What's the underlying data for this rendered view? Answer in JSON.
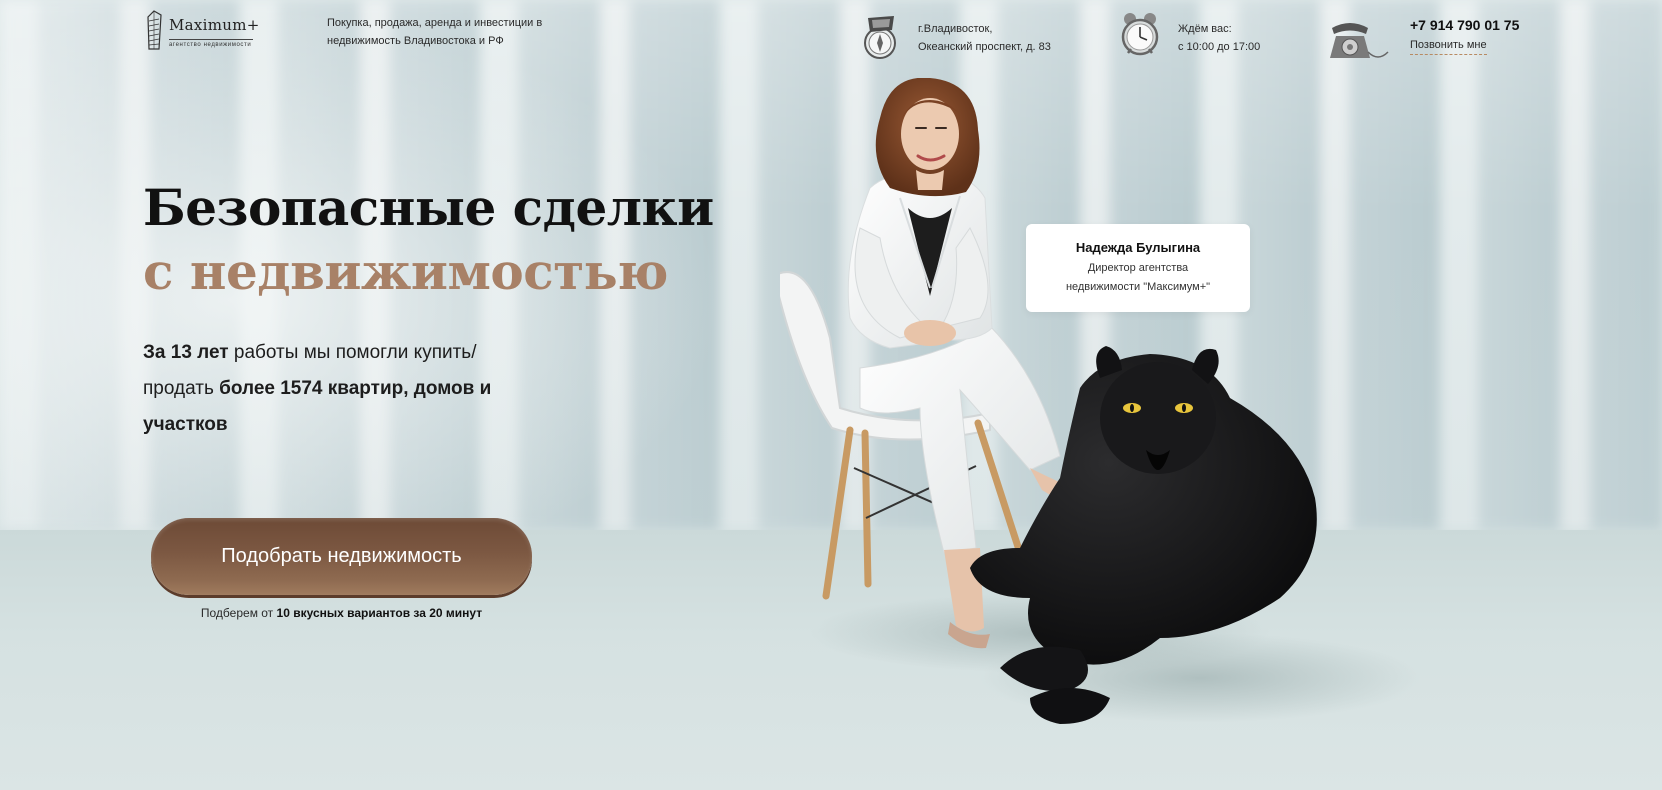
{
  "header": {
    "logo": {
      "name": "Maximum+",
      "subtitle": "агентство недвижимости"
    },
    "tagline": "Покупка, продажа, аренда и инвестиции в недвижимость Владивостока и РФ",
    "address": {
      "icon": "compass-icon",
      "line1": "г.Владивосток,",
      "line2": "Океанский проспект, д. 83"
    },
    "hours": {
      "icon": "alarm-clock-icon",
      "line1": "Ждём вас:",
      "line2": "с 10:00 до 17:00"
    },
    "contact": {
      "icon": "retro-telephone-icon",
      "phone": "+7 914 790 01 75",
      "callback": "Позвонить мне"
    }
  },
  "hero": {
    "headline_line1": "Безопасные сделки",
    "headline_line2": "с недвижимостью",
    "lead": {
      "part1_bold": "За 13 лет",
      "part2": " работы мы помогли купить/продать ",
      "part3_bold": "более 1574 квартир, домов и участков"
    },
    "cta": {
      "label": "Подобрать недвижимость",
      "note_prefix": "Подберем от ",
      "note_bold": "10 вкусных вариантов за 20 минут"
    }
  },
  "person_card": {
    "name": "Надежда Булыгина",
    "role_line1": "Директор агентства",
    "role_line2": "недвижимости \"Максимум+\""
  },
  "colors": {
    "accent": "#a88167",
    "button": "#7c5842",
    "headline": "#111111",
    "background": "#d6e2e3"
  }
}
